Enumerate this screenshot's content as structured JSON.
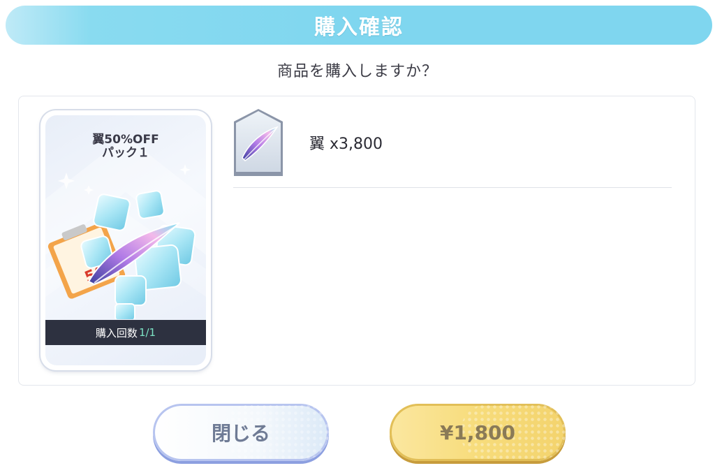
{
  "dialog": {
    "title": "購入確認",
    "question": "商品を購入しますか？"
  },
  "pack": {
    "title_line1": "翼50%OFF",
    "title_line2": "パック１",
    "purchase_label": "購入回数",
    "purchase_count": "1/1",
    "badge_text": "50%"
  },
  "item": {
    "name": "翼 x3,800",
    "icon": "wing-feather-icon"
  },
  "buttons": {
    "close_label": "閉じる",
    "buy_label": "¥1,800"
  },
  "colors": {
    "header": "#7fd6ef",
    "close_button_border": "#b7c4ef",
    "buy_button": "#f7dc7b",
    "card_footer": "#2d3140",
    "count_accent": "#7ce3c4"
  }
}
